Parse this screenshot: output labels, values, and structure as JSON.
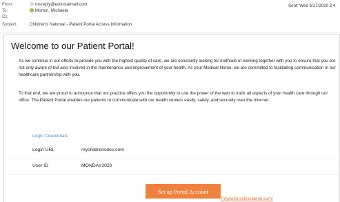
{
  "header": {
    "from_label": "From:",
    "from_value": "no-reply@eclinicalmail.com",
    "to_label": "To:",
    "to_value": "Morton, Michaela",
    "cc_label": "Cc:",
    "cc_value": "",
    "subject_label": "Subject:",
    "subject_value": "Children's National - Patient Portal Access Information",
    "sent": "Sent:  Wed 6/17/2020 2:4"
  },
  "email": {
    "title": "Welcome to our Patient Portal!",
    "paragraph1": "As we continue in our efforts to provide you with the highest quality of care, we are constantly looking for methods of working together with you to ensure that you are not only aware of but also involved in the maintenance and improvement of your health. As your Medical Home, we are committed to facilitating communication in our healthcare partnership with you.",
    "paragraph2": "To that end, we are proud to announce that our practice offers you the opportunity to use the power of the web to track all aspects of your health care through our office. The Patient Portal enables our patients to communicate with our health centers easily, safely, and securely over the Internet.",
    "credentials_title": "Login Credentials",
    "login_url_label": "Login URL",
    "login_url_value": "mychildrensdoc.com",
    "user_id_label": "User ID",
    "user_id_value": "MONDAY2020",
    "setup_button": "Set up Portal Account",
    "link_text": "[mycw26.eclinicalweb.com]"
  },
  "colors": {
    "button": "#f0813e",
    "credentials_title": "#4a90c8",
    "link": "#e07a3a"
  }
}
